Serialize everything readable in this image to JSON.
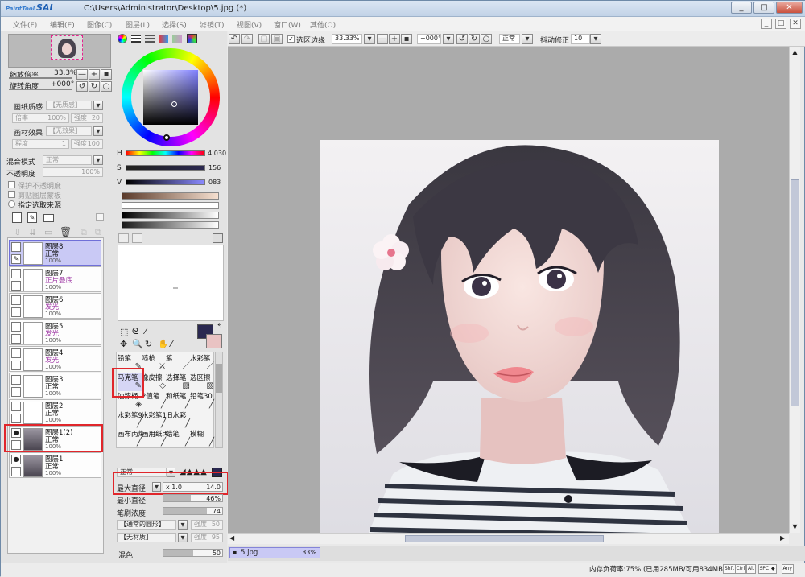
{
  "window": {
    "app_name": "SAI",
    "app_prefix": "PaintTool",
    "title": "C:\\Users\\Administrator\\Desktop\\5.jpg (*)",
    "controls": [
      "_",
      "□",
      "✕"
    ]
  },
  "menu": [
    "文件(F)",
    "编辑(E)",
    "图像(C)",
    "图层(L)",
    "选择(S)",
    "滤镜(T)",
    "视图(V)",
    "窗口(W)",
    "其他(O)"
  ],
  "navigator": {
    "zoom_label": "缩放倍率",
    "zoom_value": "33.3%",
    "angle_label": "旋转角度",
    "angle_value": "+000°"
  },
  "paper": {
    "texture_label": "画纸质感",
    "texture_value": "【无质感】",
    "scale_label": "倍率",
    "scale_value": "100%",
    "strength_label": "强度",
    "strength_value": "20",
    "effect_label": "画材效果",
    "effect_value": "【无效果】",
    "degree_label": "程度",
    "degree_value": "1",
    "strength2_value": "100"
  },
  "layer_props": {
    "blend_label": "混合模式",
    "blend_value": "正常",
    "opacity_label": "不透明度",
    "opacity_value": "100%",
    "protect_label": "保护不透明度",
    "clip_label": "剪贴图层蒙板",
    "source_label": "指定选取来源"
  },
  "layers": [
    {
      "name": "图层8",
      "mode": "正常",
      "opacity": "100%",
      "selected": true,
      "alt": false,
      "eye": "✎"
    },
    {
      "name": "图层7",
      "mode": "正片叠底",
      "opacity": "100%",
      "selected": false,
      "alt": true,
      "eye": ""
    },
    {
      "name": "图层6",
      "mode": "发光",
      "opacity": "100%",
      "selected": false,
      "alt": true,
      "eye": ""
    },
    {
      "name": "图层5",
      "mode": "发光",
      "opacity": "100%",
      "selected": false,
      "alt": true,
      "eye": ""
    },
    {
      "name": "图层4",
      "mode": "发光",
      "opacity": "100%",
      "selected": false,
      "alt": true,
      "eye": ""
    },
    {
      "name": "图层3",
      "mode": "正常",
      "opacity": "100%",
      "selected": false,
      "alt": false,
      "eye": ""
    },
    {
      "name": "图层2",
      "mode": "正常",
      "opacity": "100%",
      "selected": false,
      "alt": false,
      "eye": ""
    },
    {
      "name": "图层1(2)",
      "mode": "正常",
      "opacity": "100%",
      "selected": false,
      "alt": false,
      "eye": "👁"
    },
    {
      "name": "图层1",
      "mode": "正常",
      "opacity": "100%",
      "selected": false,
      "alt": false,
      "eye": "👁"
    }
  ],
  "color": {
    "h_label": "H",
    "h_value": "4:030",
    "s_label": "S",
    "s_value": "156",
    "v_label": "V",
    "v_value": "083",
    "primary": "#2a2850",
    "secondary": "#e9c3c3"
  },
  "brushes": [
    {
      "name": "铅笔",
      "icon": "✎"
    },
    {
      "name": "喷枪",
      "icon": "⚔"
    },
    {
      "name": "笔",
      "icon": "／"
    },
    {
      "name": "水彩笔",
      "icon": "／"
    },
    {
      "name": "马克笔",
      "icon": "✎"
    },
    {
      "name": "橡皮擦",
      "icon": "◇"
    },
    {
      "name": "选择笔",
      "icon": "▨"
    },
    {
      "name": "选区擦",
      "icon": "▧"
    },
    {
      "name": "油漆桶",
      "icon": "◈"
    },
    {
      "name": "2值笔",
      "icon": "╱"
    },
    {
      "name": "和纸笔",
      "icon": "╱"
    },
    {
      "name": "铅笔30",
      "icon": "╱"
    },
    {
      "name": "水彩笔9腻",
      "icon": "╱"
    },
    {
      "name": "水彩笔10腻",
      "icon": "╱"
    },
    {
      "name": "旧水彩",
      "icon": "╱"
    },
    {
      "name": "",
      "icon": ""
    },
    {
      "name": "画布丙烯",
      "icon": "╱"
    },
    {
      "name": "画用纸丙烯",
      "icon": "╱"
    },
    {
      "name": "蜡笔",
      "icon": "╱"
    },
    {
      "name": "模糊",
      "icon": "╱"
    }
  ],
  "brush_settings": {
    "mode_value": "正常",
    "max_size_label": "最大直径",
    "max_size_mult": "x 1.0",
    "max_size_value": "14.0",
    "min_size_label": "最小直径",
    "min_size_value": "46%",
    "min_size_fill": 0.46,
    "density_label": "笔刷浓度",
    "density_value": "74",
    "density_fill": 0.74,
    "shape_value": "【通常的圆形】",
    "shape_strength_label": "强度",
    "shape_strength_value": "50",
    "texture_value": "【无材质】",
    "texture_strength_label": "强度",
    "texture_strength_value": "95",
    "mix_label": "混色",
    "mix_value": "50",
    "mix_fill": 0.5
  },
  "toolbar": {
    "selection_edge_label": "选区边缘",
    "zoom_value": "33.33%",
    "angle_value": "+000°",
    "mode_value": "正常",
    "stabilizer_label": "抖动修正",
    "stabilizer_value": "10"
  },
  "document_tab": {
    "name": "5.jpg",
    "zoom": "33%"
  },
  "status": {
    "memory": "内存负荷率:75% (已用285MB/可用834MB)",
    "keys": [
      "Shft",
      "Ctrl",
      "Alt",
      "SPC",
      "◆",
      "Any"
    ]
  }
}
